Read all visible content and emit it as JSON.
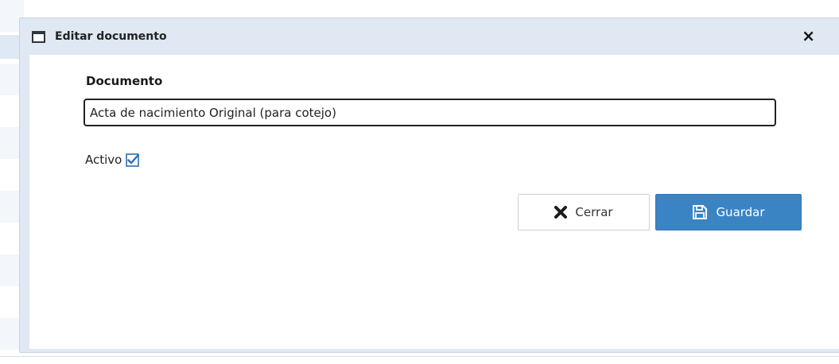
{
  "modal": {
    "title": "Editar documento",
    "close_symbol": "×",
    "window_icon": "window-icon"
  },
  "form": {
    "document_label": "Documento",
    "document_value": "Acta de nacimiento Original (para cotejo)",
    "active_label": "Activo",
    "active_checked": true
  },
  "buttons": {
    "close_label": "Cerrar",
    "close_icon": "x-icon",
    "save_label": "Guardar",
    "save_icon": "floppy-disk-icon"
  },
  "colors": {
    "primary": "#3b84c4",
    "header_bg": "#dfe8f3",
    "checkbox": "#2e6fb0"
  }
}
